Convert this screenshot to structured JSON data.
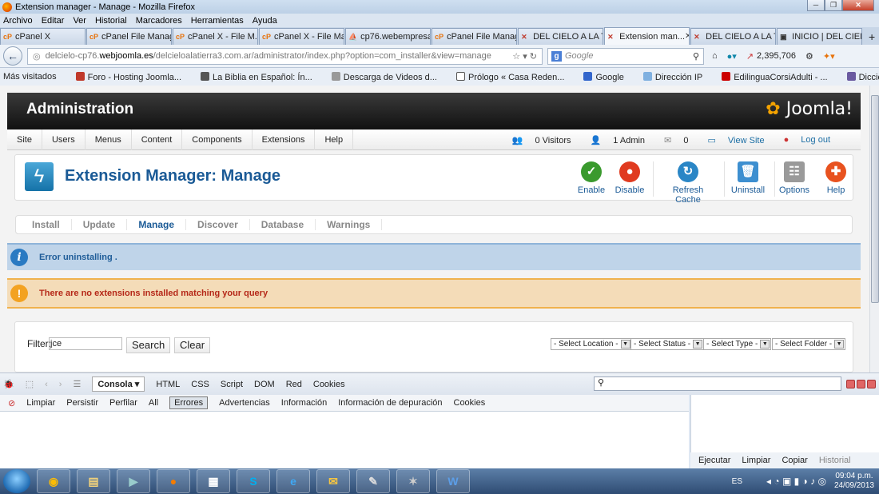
{
  "window": {
    "title": "Extension manager - Manage - Mozilla Firefox"
  },
  "menubar": [
    "Archivo",
    "Editar",
    "Ver",
    "Historial",
    "Marcadores",
    "Herramientas",
    "Ayuda"
  ],
  "tabs": [
    {
      "label": "cPanel X",
      "icon": "cpanel-icon"
    },
    {
      "label": "cPanel File Manag...",
      "icon": "cpanel-icon"
    },
    {
      "label": "cPanel X - File M...",
      "icon": "cpanel-icon"
    },
    {
      "label": "cPanel X - File Ma...",
      "icon": "cpanel-icon"
    },
    {
      "label": "cp76.webempresa...",
      "icon": "pma-icon"
    },
    {
      "label": "cPanel File Manag...",
      "icon": "cpanel-icon"
    },
    {
      "label": "DEL CIELO A LA TI...",
      "icon": "joomla-icon"
    },
    {
      "label": "Extension man...",
      "icon": "joomla-icon",
      "active": true
    },
    {
      "label": "DEL CIELO A LA TI...",
      "icon": "joomla-icon"
    },
    {
      "label": "INICIO | DEL CIEL...",
      "icon": "page-icon"
    }
  ],
  "url": {
    "pre": "delcielo-cp76.",
    "domain": "webjoomla.es",
    "post": "/delcieloalatierra3.com.ar/administrator/index.php?option=com_installer&view=manage"
  },
  "search_engine_placeholder": "Google",
  "nav_counter": "2,395,706",
  "bookmarks": [
    "Más visitados",
    "Foro - Hosting Joomla...",
    "La Biblia en Español: Ín...",
    "Descarga de Videos d...",
    "Prólogo « Casa Reden...",
    "Google",
    "Dirección IP",
    "EdilinguaCorsiAdulti - ...",
    "Diccionario de la leng..."
  ],
  "joomla": {
    "header_title": "Administration",
    "logo": "Joomla!",
    "menu": [
      "Site",
      "Users",
      "Menus",
      "Content",
      "Components",
      "Extensions",
      "Help"
    ],
    "status": {
      "visitors": "0 Visitors",
      "admin": "1 Admin",
      "messages": "0",
      "view_site": "View Site",
      "logout": "Log out"
    },
    "page_title": "Extension Manager: Manage",
    "toolbar": [
      {
        "label": "Enable",
        "color": "#3a9a2e",
        "icon": "check-icon"
      },
      {
        "label": "Disable",
        "color": "#e03a1f",
        "icon": "disable-icon"
      },
      {
        "label": "Refresh Cache",
        "color": "#2a86c6",
        "icon": "refresh-icon"
      },
      {
        "label": "Uninstall",
        "color": "#3d8fd0",
        "icon": "trash-icon"
      },
      {
        "label": "Options",
        "color": "#9a9a9a",
        "icon": "options-icon"
      },
      {
        "label": "Help",
        "color": "#e8521f",
        "icon": "help-icon"
      }
    ],
    "subnav": [
      "Install",
      "Update",
      "Manage",
      "Discover",
      "Database",
      "Warnings"
    ],
    "subnav_active": "Manage",
    "msg_info": "Error uninstalling .",
    "msg_warning": "There are no extensions installed matching your query",
    "filter": {
      "label": "Filter:",
      "value": "jce",
      "search": "Search",
      "clear": "Clear"
    },
    "selects": [
      "- Select Location -",
      "- Select Status -",
      "- Select Type -",
      "- Select Folder -"
    ]
  },
  "firebug": {
    "tabs": [
      "Consola",
      "HTML",
      "CSS",
      "Script",
      "DOM",
      "Red",
      "Cookies"
    ],
    "console_tools": [
      "Limpiar",
      "Persistir",
      "Perfilar",
      "All",
      "Errores",
      "Advertencias",
      "Información",
      "Información de depuración",
      "Cookies"
    ],
    "active_filter": "Errores",
    "side_tools": [
      "Ejecutar",
      "Limpiar",
      "Copiar",
      "Historial"
    ]
  },
  "taskbar": {
    "lang": "ES",
    "time": "09:04 p.m.",
    "date": "24/09/2013"
  }
}
